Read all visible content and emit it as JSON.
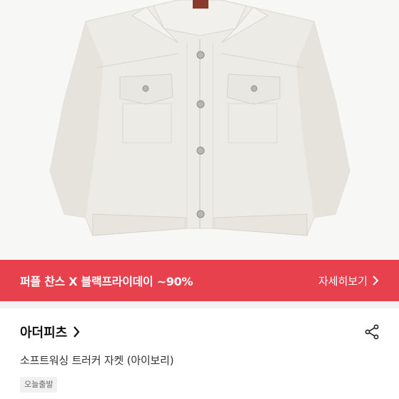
{
  "product_image": {
    "icon": "jacket-photo"
  },
  "promo_banner": {
    "text": "퍼플 찬스 X 블랙프라이데이 ~90%",
    "link_label": "자세히보기",
    "color": "#e8414e"
  },
  "shop": {
    "name": "아더피츠"
  },
  "product": {
    "title": "소프트워싱 트러커 자켓 (아이보리)",
    "tag": "오늘출발"
  },
  "icons": {
    "share": "share-icon",
    "shop_arrow": "chevron-right-icon",
    "promo_arrow": "chevron-right-icon"
  }
}
